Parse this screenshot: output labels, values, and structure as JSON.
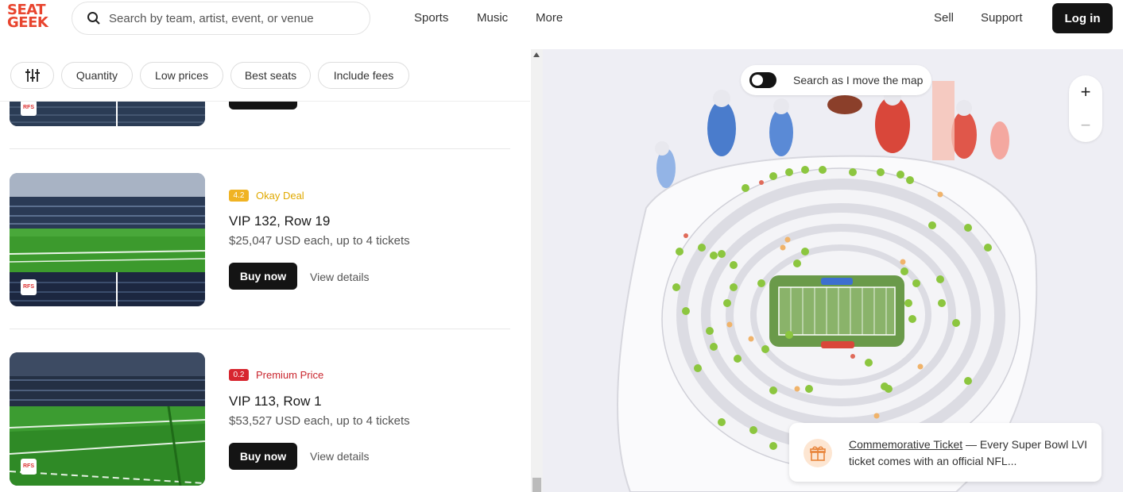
{
  "header": {
    "logo_line1": "SEAT",
    "logo_line2": "GEEK",
    "search_placeholder": "Search by team, artist, event, or venue",
    "nav": [
      "Sports",
      "Music",
      "More"
    ],
    "right_nav": [
      "Sell",
      "Support"
    ],
    "login_label": "Log in"
  },
  "filters": {
    "chips": [
      "Quantity",
      "Low prices",
      "Best seats",
      "Include fees"
    ]
  },
  "listings": [
    {
      "score": "4.2",
      "score_color": "#f0b323",
      "deal_label": "Okay Deal",
      "deal_color": "#e0a900",
      "title": "VIP 132, Row 19",
      "price": "$25,047 USD each, up to 4 tickets",
      "buy_label": "Buy now",
      "details_label": "View details"
    },
    {
      "score": "0.2",
      "score_color": "#d7262f",
      "deal_label": "Premium Price",
      "deal_color": "#c9262e",
      "title": "VIP 113, Row 1",
      "price": "$53,527 USD each, up to 4 tickets",
      "buy_label": "Buy now",
      "details_label": "View details"
    }
  ],
  "map": {
    "toggle_label": "Search as I move the map",
    "zoom_in": "+",
    "zoom_out": "−",
    "promo_link": "Commemorative Ticket",
    "promo_text": " — Every Super Bowl LVI ticket comes with an official NFL..."
  }
}
